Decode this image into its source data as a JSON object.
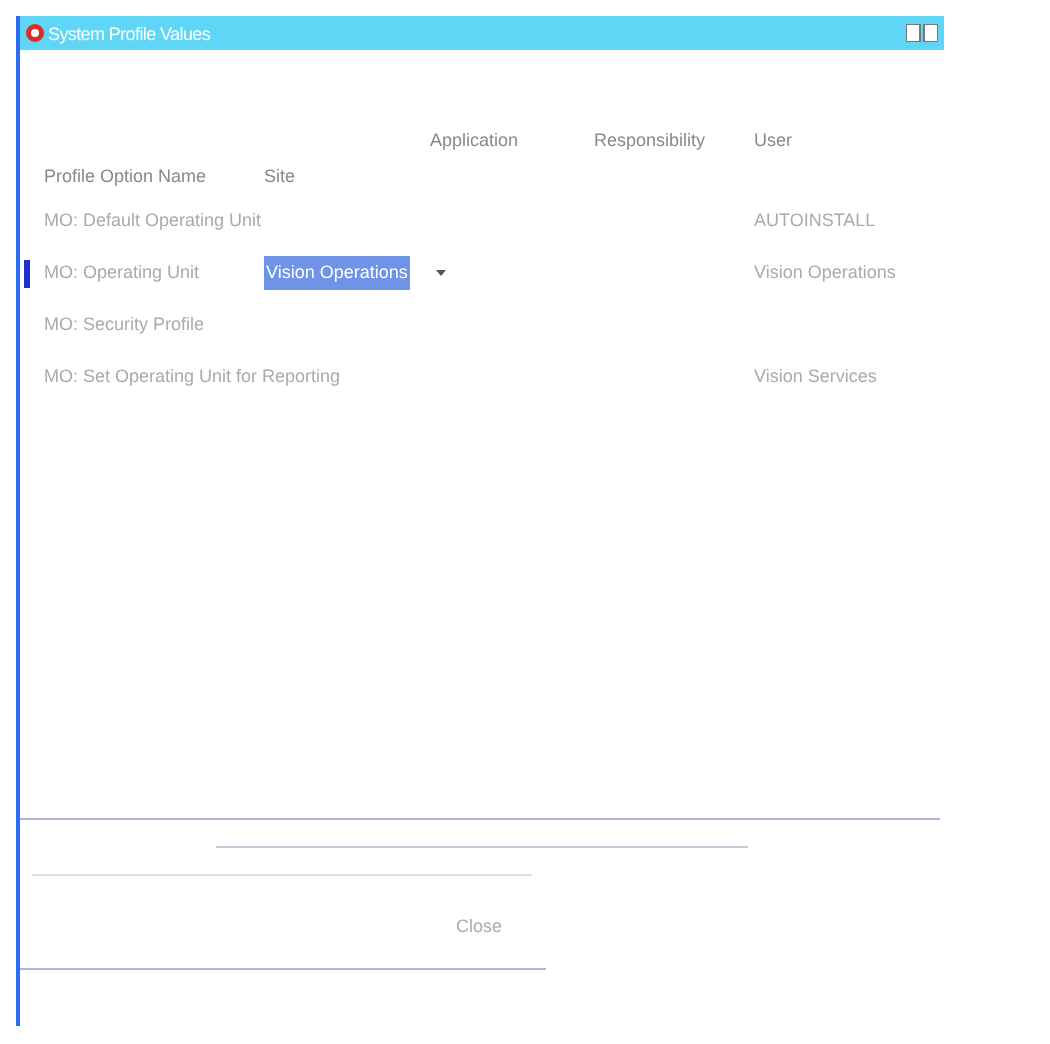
{
  "window": {
    "title": "System Profile Values"
  },
  "columns": {
    "application": "Application",
    "responsibility": "Responsibility",
    "user": "User",
    "profile_option_name": "Profile Option Name",
    "site": "Site"
  },
  "rows": [
    {
      "name": "MO: Default Operating Unit",
      "site": "",
      "user": "AUTOINSTALL",
      "selected": false
    },
    {
      "name": "MO: Operating Unit",
      "site": "Vision Operations",
      "user": "Vision Operations",
      "selected": true
    },
    {
      "name": "MO: Security Profile",
      "site": "",
      "user": "",
      "selected": false
    },
    {
      "name": "MO: Set Operating Unit for Reporting",
      "site": "",
      "user": "Vision Services",
      "selected": false
    }
  ],
  "buttons": [
    {
      "label": "Close"
    }
  ]
}
